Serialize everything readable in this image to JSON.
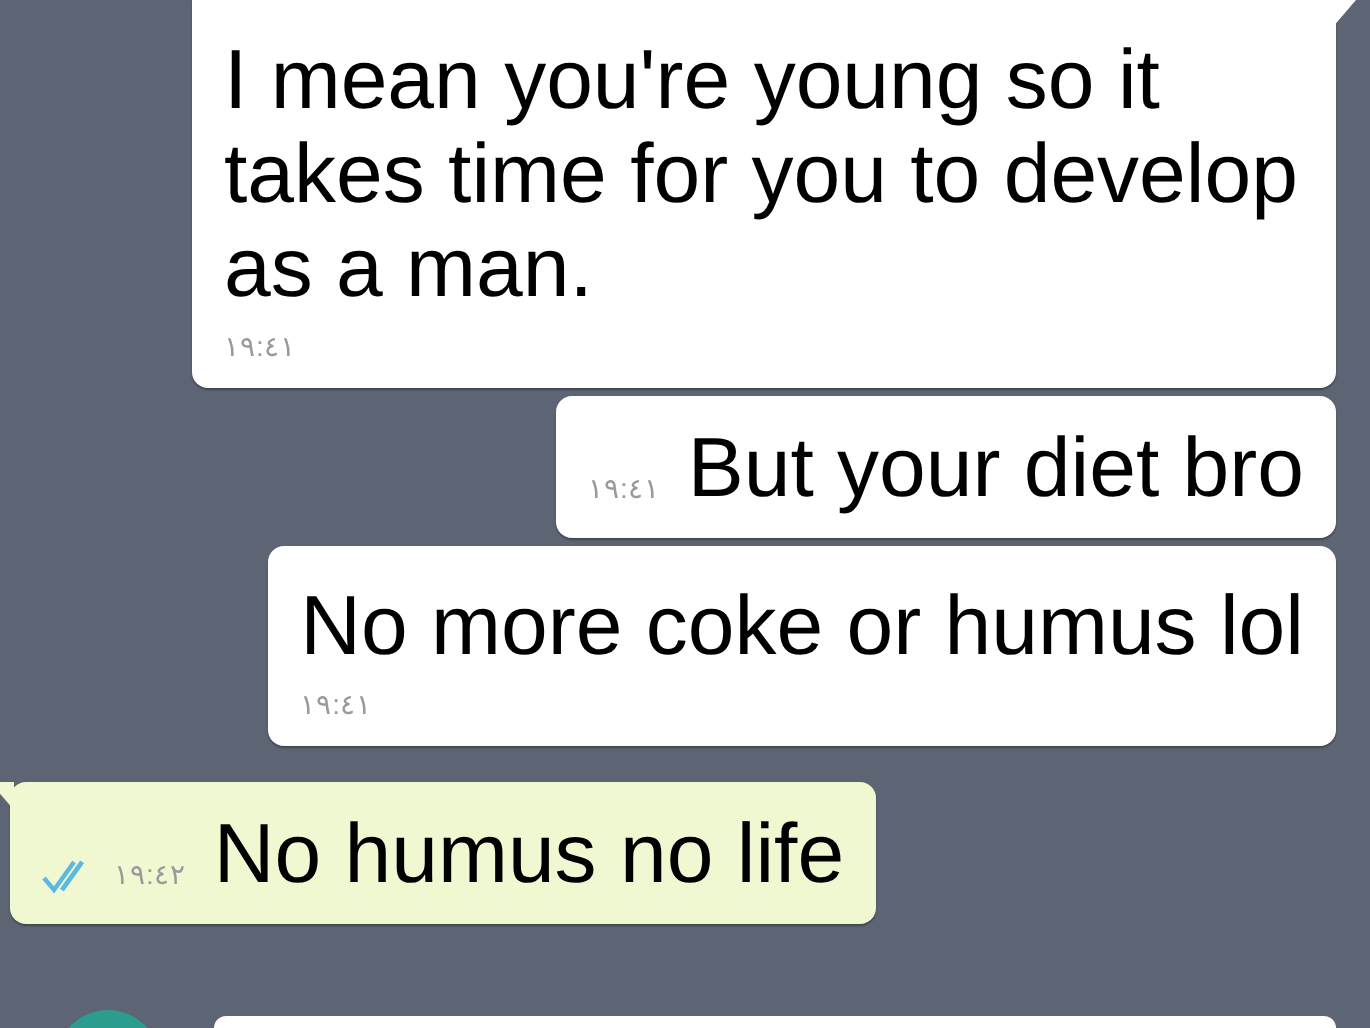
{
  "messages": [
    {
      "kind": "incoming",
      "text": "I mean you're young so it takes time for you to develop as a man.",
      "time": "١٩:٤١",
      "tail": true,
      "time_inline": false
    },
    {
      "kind": "incoming",
      "text": "But your diet bro",
      "time": "١٩:٤١",
      "tail": false,
      "time_inline": true
    },
    {
      "kind": "incoming",
      "text": "No more coke or humus lol",
      "time": "١٩:٤١",
      "tail": false,
      "time_inline": false
    },
    {
      "kind": "outgoing",
      "text": "No humus no life",
      "time": "١٩:٤٢",
      "tail": true,
      "time_inline": true,
      "read": true
    }
  ]
}
